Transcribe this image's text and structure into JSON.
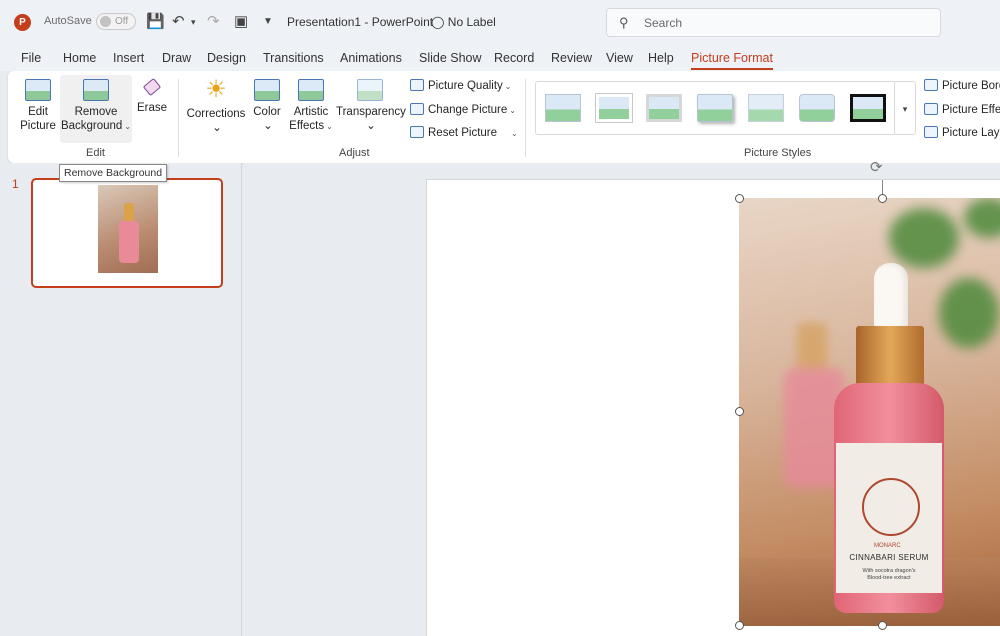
{
  "titlebar": {
    "logo": "P",
    "autosave_label": "AutoSave",
    "autosave_state": "Off",
    "doc_title": "Presentation1  -  PowerPoint",
    "sensitivity_label": "No Label",
    "search_placeholder": "Search"
  },
  "tabs": [
    "File",
    "Home",
    "Insert",
    "Draw",
    "Design",
    "Transitions",
    "Animations",
    "Slide Show",
    "Record",
    "Review",
    "View",
    "Help",
    "Picture Format"
  ],
  "active_tab": "Picture Format",
  "ribbon": {
    "edit": {
      "group_label": "Edit",
      "edit_picture_1": "Edit",
      "edit_picture_2": "Picture",
      "remove_bg_1": "Remove",
      "remove_bg_2": "Background",
      "erase": "Erase"
    },
    "adjust": {
      "group_label": "Adjust",
      "corrections": "Corrections",
      "color": "Color",
      "artistic_1": "Artistic",
      "artistic_2": "Effects",
      "transparency": "Transparency",
      "picture_quality": "Picture Quality",
      "change_picture": "Change Picture",
      "reset_picture": "Reset Picture"
    },
    "styles": {
      "group_label": "Picture Styles",
      "picture_border": "Picture Bord",
      "picture_effects": "Picture Effe",
      "picture_layout": "Picture Layo"
    }
  },
  "tooltip": "Remove Background",
  "slides": {
    "number": "1"
  },
  "photo": {
    "brand": "MONARC",
    "product_name": "CINNABARI SERUM",
    "product_sub_1": "With socotra dragon's",
    "product_sub_2": "Blood-tree extract"
  },
  "colors": {
    "accent": "#c43e1c",
    "ribbon_bg": "#ffffff",
    "chrome_bg": "#eef1f5"
  }
}
